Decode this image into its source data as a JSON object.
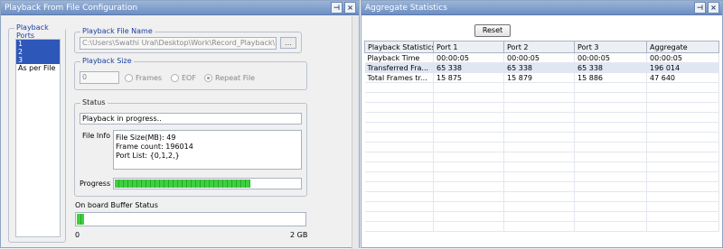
{
  "left": {
    "title": "Playback From File Configuration",
    "title_buttons": [
      "⊣",
      "×"
    ],
    "ports_group": "Playback Ports",
    "ports": [
      "1",
      "2",
      "3",
      "As per File"
    ],
    "file_name_group": "Playback File Name",
    "file_path": "C:\\Users\\Swathi Ural\\Desktop\\Work\\Record_Playback\\pc",
    "browse_label": "...",
    "size_group": "Playback Size",
    "size_value": "0",
    "radio_frames": "Frames",
    "radio_eof": "EOF",
    "radio_repeat": "Repeat File",
    "status_group": "Status",
    "status_text": "Playback in progress..",
    "file_info_label": "File Info",
    "file_info": {
      "size": "File Size(MB): 49",
      "frame_count": "Frame count: 196014",
      "port_list": "Port List: {0,1,2,}"
    },
    "progress_label": "Progress",
    "progress_value": 0.73,
    "buffer_label": "On board Buffer Status",
    "buffer_value": 0.03,
    "buffer_min": "0",
    "buffer_max": "2 GB"
  },
  "right": {
    "title": "Aggregate Statistics",
    "title_buttons": [
      "⊣",
      "×"
    ],
    "reset_label": "Reset",
    "columns": [
      "Playback Statistics",
      "Port 1",
      "Port 2",
      "Port 3",
      "Aggregate"
    ],
    "rows": [
      [
        "Playback Time",
        "00:00:05",
        "00:00:05",
        "00:00:05",
        "00:00:05"
      ],
      [
        "Transferred Fra...",
        "65 338",
        "65 338",
        "65 338",
        " 196 014"
      ],
      [
        "Total Frames tr...",
        "15 875",
        "15 879",
        "15 886",
        "47 640"
      ]
    ],
    "highlight_row": 1,
    "empty_rows": 15
  }
}
